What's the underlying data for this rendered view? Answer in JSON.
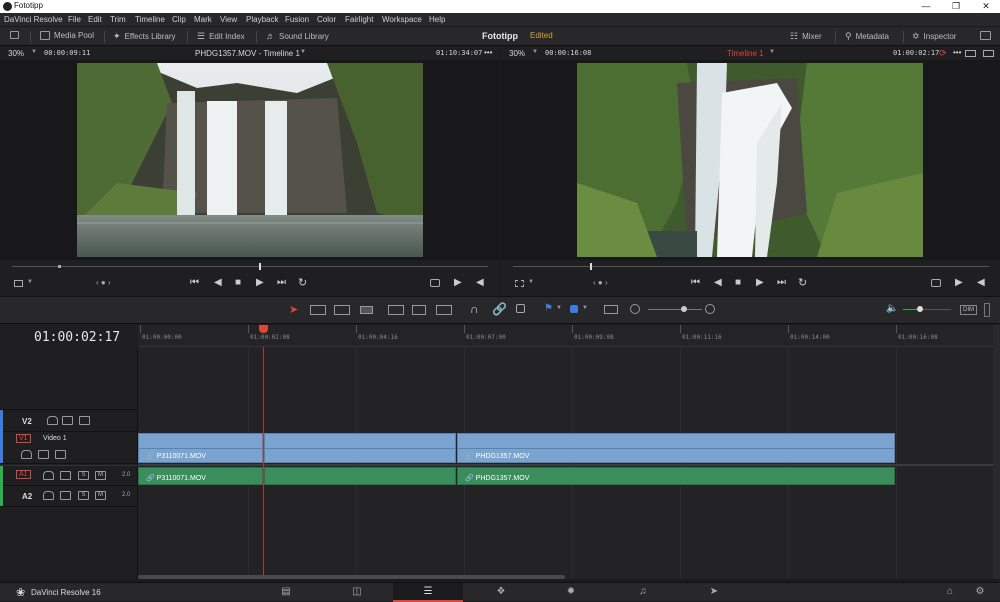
{
  "window": {
    "title": "Fototipp"
  },
  "menu": [
    "DaVinci Resolve",
    "File",
    "Edit",
    "Trim",
    "Timeline",
    "Clip",
    "Mark",
    "View",
    "Playback",
    "Fusion",
    "Color",
    "Fairlight",
    "Workspace",
    "Help"
  ],
  "toolbar": {
    "media_pool": "Media Pool",
    "effects_library": "Effects Library",
    "edit_index": "Edit Index",
    "sound_library": "Sound Library",
    "project_name": "Fototipp",
    "project_status": "Edited",
    "mixer": "Mixer",
    "metadata": "Metadata",
    "inspector": "Inspector"
  },
  "source_viewer": {
    "zoom": "30%",
    "timecode_left": "00:00:09:11",
    "clip_title": "PHDG1357.MOV - Timeline 1",
    "timecode_right": "01:10:34:07",
    "dots": "•••",
    "nav": "‹ ● ›"
  },
  "timeline_viewer": {
    "zoom": "30%",
    "timecode_left": "00:00:16:08",
    "timeline_name": "Timeline 1",
    "timecode_right": "01:00:02:17",
    "dots": "•••",
    "nav": "‹ ● ›"
  },
  "timeline": {
    "current_timecode": "01:00:02:17",
    "ruler": [
      "01:00:00:00",
      "01:00:02:08",
      "01:00:04:16",
      "01:00:07:00",
      "01:00:09:08",
      "01:00:11:16",
      "01:00:14:00",
      "01:00:16:08"
    ],
    "tracks": {
      "v2": {
        "name": "V2"
      },
      "v1": {
        "name": "V1",
        "label": "Video 1"
      },
      "a1": {
        "name": "A1",
        "level": "2.0"
      },
      "a2": {
        "name": "A2",
        "level": "2.0"
      }
    },
    "clips": {
      "v1_a": "P3110071.MOV",
      "v1_b": "PHDG1357.MOV",
      "a1_a": "P3110071.MOV",
      "a1_b": "PHDG1357.MOV"
    },
    "audio_btns": {
      "solo": "S",
      "mute": "M"
    },
    "dim": "DIM"
  },
  "pagebar": {
    "app_label": "DaVinci Resolve 16"
  },
  "colors": {
    "video_clip": "#7ba3cf",
    "audio_clip": "#3a8e5c",
    "accent_red": "#e0453a",
    "edited": "#d7a63a",
    "playhead": "#e0453a"
  }
}
